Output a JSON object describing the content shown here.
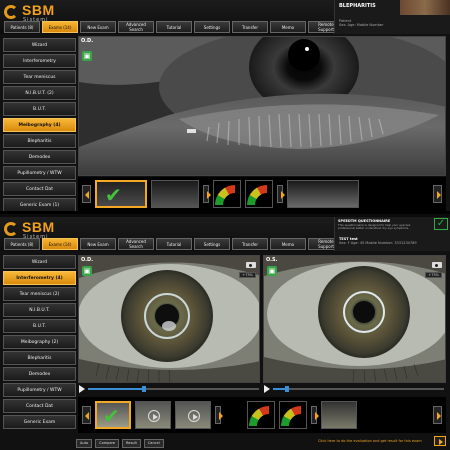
{
  "top": {
    "logo": {
      "name": "SBM",
      "sub": "Sistemi"
    },
    "tabs": [
      "Patients (8)",
      "Exams (14)",
      "New Exam",
      "Advanced\nSearch",
      "Tutorial",
      "Settings",
      "Transfer",
      "Memo",
      "Remote\nSupport"
    ],
    "active_tab": 1,
    "patient_name": "Patient",
    "patient_info": "Sex:  Age:  Mobile Number",
    "exam_title": "BLEPHARITIS",
    "sidebar": [
      "Wizard",
      "Interferometry",
      "Tear meniscus",
      "N.I.B.U.T. (2)",
      "B.U.T.",
      "Meibography (4)",
      "Blepharitis",
      "Demodex",
      "Pupillometry / WTW",
      "Contact Dat",
      "Generic Exam (1)"
    ],
    "active_sidebar": 5,
    "eye_label": "O.D."
  },
  "bottom": {
    "logo": {
      "name": "SBM",
      "sub": "Sistemi"
    },
    "tabs": [
      "Patients (8)",
      "Exams (14)",
      "New Exam",
      "Advanced\nSearch",
      "Tutorial",
      "Settings",
      "Transfer",
      "Memo",
      "Remote\nSupport"
    ],
    "active_tab": 1,
    "questionnaire_title": "SPEEDTM QUESTIONNAIRE",
    "questionnaire_desc": "This questionnaire is designed to help your eyecare professional better understand dry eye symptoms.",
    "patient_name": "TEST test",
    "patient_info": "Sex: F   Age: 45   Mobile Number: 3331234789",
    "sidebar": [
      "Wizard",
      "Interferometry (4)",
      "Tear meniscus (2)",
      "N.I.B.U.T.",
      "B.U.T.",
      "Meibography (2)",
      "Blepharitis",
      "Demodex",
      "Pupillometry / WTW",
      "Contact Dat",
      "Generic Exam"
    ],
    "active_sidebar": 1,
    "eye_label_left": "O.D.",
    "eye_label_right": "O.S.",
    "tag_left": "+75%",
    "tag_right": "+75%",
    "toolbar": [
      "Auto",
      "Compare",
      "Result",
      "Cancel"
    ],
    "evaluate_hint": "Click here to do the evaluation and get result for this exam",
    "scrub_left_progress": 0.33,
    "scrub_right_progress": 0.08
  }
}
